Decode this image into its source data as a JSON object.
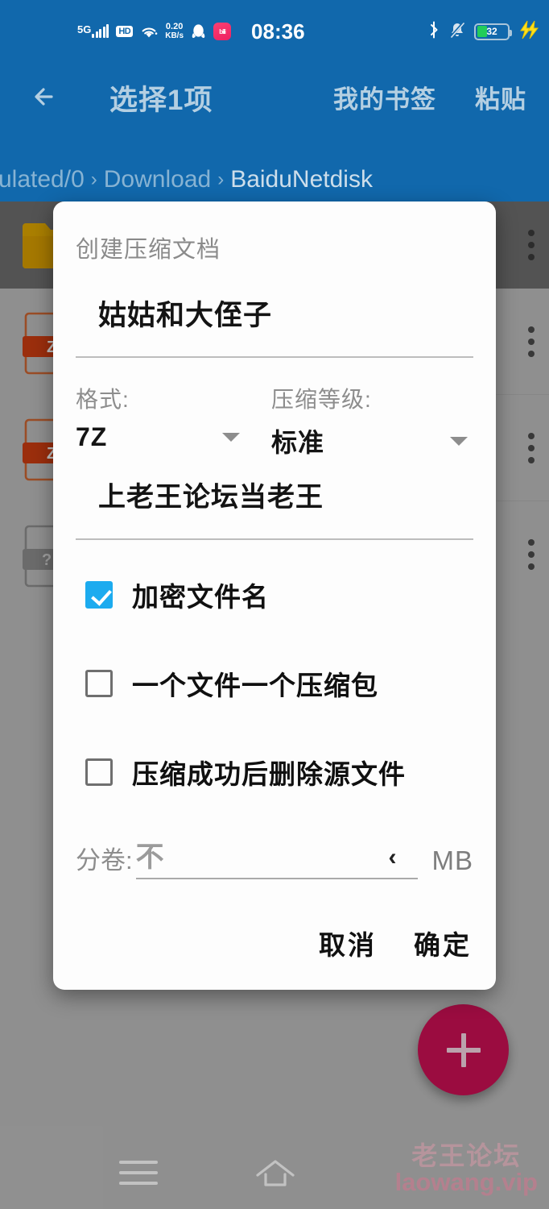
{
  "colors": {
    "toolbar_blue": "#1168ac",
    "accent_checkbox": "#1cabef",
    "fab_pink": "#cc1155",
    "battery_green": "#22cc5a",
    "zip_icon": "#cc3d12"
  },
  "status_bar": {
    "network_label": "5G",
    "volte_label": "HD",
    "wifi_icon": "wifi-icon",
    "data_speed_value": "0.20",
    "data_speed_unit": "KB/s",
    "qq_icon": "qq-icon",
    "app_icon_label": "bili",
    "clock": "08:36",
    "bluetooth_icon": "bluetooth-icon",
    "mute_icon": "bell-muted-icon",
    "battery_percent": "32",
    "charging_icon": "lightning-icon"
  },
  "toolbar": {
    "back_icon": "arrow-left-icon",
    "title": "选择1项",
    "action_bookmarks": "我的书签",
    "action_paste": "粘贴"
  },
  "breadcrumb": {
    "separator": "›",
    "items": [
      "ulated/0",
      "Download",
      "BaiduNetdisk"
    ]
  },
  "file_list": {
    "rows": [
      {
        "icon": "folder-icon",
        "selected": true,
        "overflow_icon": "more-vertical-icon"
      },
      {
        "icon": "zip-file-icon",
        "selected": false,
        "overflow_icon": "more-vertical-icon"
      },
      {
        "icon": "zip-file-icon",
        "selected": false,
        "overflow_icon": "more-vertical-icon"
      },
      {
        "icon": "unknown-file-icon",
        "selected": false,
        "overflow_icon": "more-vertical-icon"
      }
    ]
  },
  "fab": {
    "icon": "plus-icon"
  },
  "watermark": {
    "line1": "老王论坛",
    "line2": "laowang.vip"
  },
  "navbar": {
    "menu_icon": "menu-icon",
    "home_icon": "home-icon"
  },
  "dialog": {
    "title": "创建压缩文档",
    "archive_name": {
      "value": "姑姑和大侄子",
      "placeholder": ""
    },
    "format": {
      "label": "格式:",
      "value": "7Z",
      "caret_icon": "chevron-down-icon"
    },
    "level": {
      "label": "压缩等级:",
      "value": "标准",
      "caret_icon": "chevron-down-icon"
    },
    "password": {
      "value": "上老王论坛当老王",
      "placeholder": ""
    },
    "checkboxes": [
      {
        "label": "加密文件名",
        "checked": true
      },
      {
        "label": "一个文件一个压缩包",
        "checked": false
      },
      {
        "label": "压缩成功后删除源文件",
        "checked": false
      }
    ],
    "split": {
      "label": "分卷:",
      "value": "不",
      "chevron_icon": "chevron-left-icon",
      "unit": "MB"
    },
    "cancel_label": "取消",
    "confirm_label": "确定"
  }
}
